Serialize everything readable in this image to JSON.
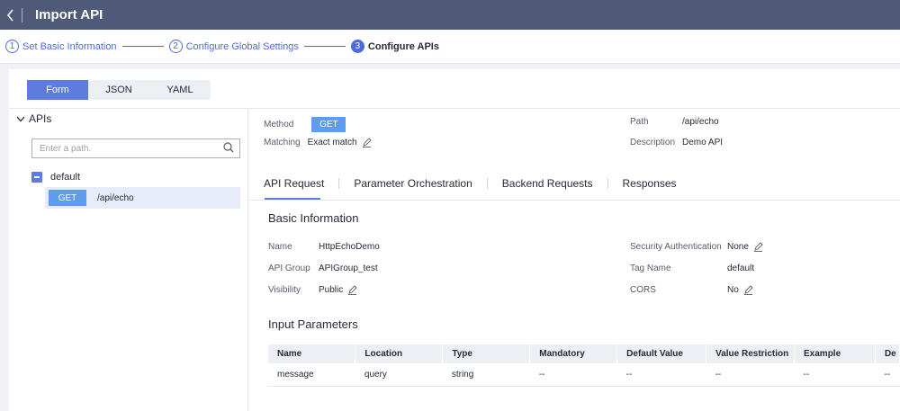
{
  "header": {
    "title": "Import API"
  },
  "steps": [
    {
      "num": "1",
      "label": "Set Basic Information"
    },
    {
      "num": "2",
      "label": "Configure Global Settings"
    },
    {
      "num": "3",
      "label": "Configure APIs"
    }
  ],
  "format_tabs": [
    "Form",
    "JSON",
    "YAML"
  ],
  "sidebar": {
    "title": "APIs",
    "search_placeholder": "Enter a path.",
    "group": "default",
    "api": {
      "method": "GET",
      "path": "/api/echo"
    }
  },
  "summary": {
    "method_label": "Method",
    "method_value": "GET",
    "matching_label": "Matching",
    "matching_value": "Exact match",
    "path_label": "Path",
    "path_value": "/api/echo",
    "desc_label": "Description",
    "desc_value": "Demo API"
  },
  "tabs": [
    "API Request",
    "Parameter Orchestration",
    "Backend Requests",
    "Responses"
  ],
  "basic": {
    "title": "Basic Information",
    "name_label": "Name",
    "name_value": "HttpEchoDemo",
    "group_label": "API Group",
    "group_value": "APIGroup_test",
    "visibility_label": "Visibility",
    "visibility_value": "Public",
    "auth_label": "Security Authentication",
    "auth_value": "None",
    "tag_label": "Tag Name",
    "tag_value": "default",
    "cors_label": "CORS",
    "cors_value": "No"
  },
  "input_params": {
    "title": "Input Parameters",
    "columns": [
      "Name",
      "Location",
      "Type",
      "Mandatory",
      "Default Value",
      "Value Restriction",
      "Example",
      "De"
    ],
    "rows": [
      [
        "message",
        "query",
        "string",
        "--",
        "--",
        "--",
        "--",
        "--"
      ]
    ]
  },
  "colors": {
    "accent": "#5e7ce0",
    "topbar": "#4e5a78",
    "get_tag": "#5e9cf0"
  }
}
